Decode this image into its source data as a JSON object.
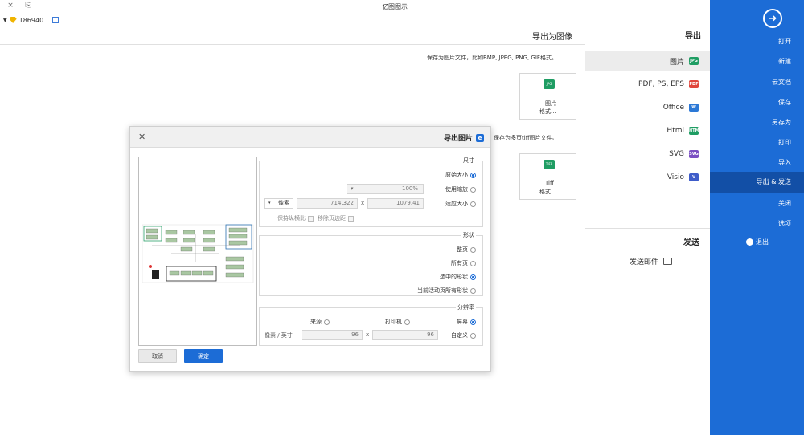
{
  "window": {
    "title": "亿图图示",
    "controls": [
      "×",
      "⎘"
    ]
  },
  "user": {
    "name": "186940..."
  },
  "sidebar": {
    "back_icon": "arrow-right-circle-icon",
    "items": [
      "打开",
      "新建",
      "云文档",
      "保存",
      "另存为",
      "打印",
      "导入",
      "导出 & 发送",
      "关闭",
      "选项"
    ],
    "exit_label": "退出"
  },
  "options": {
    "export_header": "导出",
    "formats": [
      {
        "label": "图片",
        "icon": "JPG"
      },
      {
        "label": "PDF, PS, EPS",
        "icon": "PDF"
      },
      {
        "label": "Office",
        "icon": "W"
      },
      {
        "label": "Html",
        "icon": "HTML"
      },
      {
        "label": "SVG",
        "icon": "SVG"
      },
      {
        "label": "Visio",
        "icon": "V"
      }
    ],
    "send_header": "发送",
    "send_email": "发送邮件"
  },
  "main": {
    "title": "导出为图像",
    "desc_image": "保存为图片文件，比如BMP, JPEG, PNG, GIF格式。",
    "card_image": {
      "icon": "JPG",
      "line1": "图片",
      "line2": "格式..."
    },
    "desc_tiff": "保存为多页tiff图片文件。",
    "card_tiff": {
      "icon": "TIFF",
      "line1": "Tiff",
      "line2": "格式..."
    }
  },
  "dialog": {
    "title": "导出图片",
    "size": {
      "label": "尺寸",
      "original": "原始大小",
      "scale": "使用缩放",
      "scale_value": "100%",
      "custom": "适应大小",
      "width": "1079.41",
      "height": "714.322",
      "unit": "像素",
      "remove_margin": "移除页边距",
      "keep_ratio": "保持纵横比"
    },
    "shape": {
      "label": "形状",
      "current_page": "整页",
      "all_pages": "所有页",
      "selected": "选中的形状",
      "current_selected": "当前活动页所有形状"
    },
    "resolution": {
      "label": "分辨率",
      "screen": "屏幕",
      "printer": "打印机",
      "source": "来源",
      "custom": "自定义",
      "x_value": "96",
      "y_value": "96",
      "unit": "像素 / 英寸"
    },
    "ok": "确定",
    "cancel": "取消"
  }
}
